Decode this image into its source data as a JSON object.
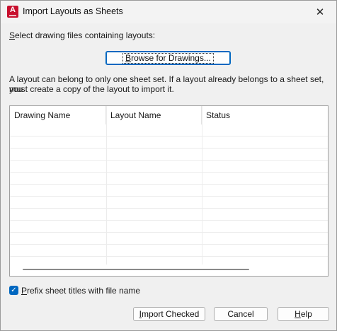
{
  "window": {
    "title": "Import Layouts as Sheets",
    "close_symbol": "✕"
  },
  "instructions": {
    "select_label_hotkey": "S",
    "select_label_rest": "elect drawing files containing layouts:",
    "info_line1": "A layout can belong to only one sheet set. If a layout already belongs to a sheet set, you",
    "info_line2": "must create a copy of the layout to import it."
  },
  "browse_button": {
    "hotkey": "B",
    "rest": "rowse for Drawings..."
  },
  "table": {
    "columns": [
      "Drawing Name",
      "Layout Name",
      "Status"
    ],
    "rows": []
  },
  "prefix_checkbox": {
    "checked": true,
    "hotkey": "P",
    "rest": "refix sheet titles with file name"
  },
  "buttons": {
    "import_hotkey": "I",
    "import_rest": "mport Checked",
    "cancel": "Cancel",
    "help_hotkey": "H",
    "help_rest": "elp"
  }
}
